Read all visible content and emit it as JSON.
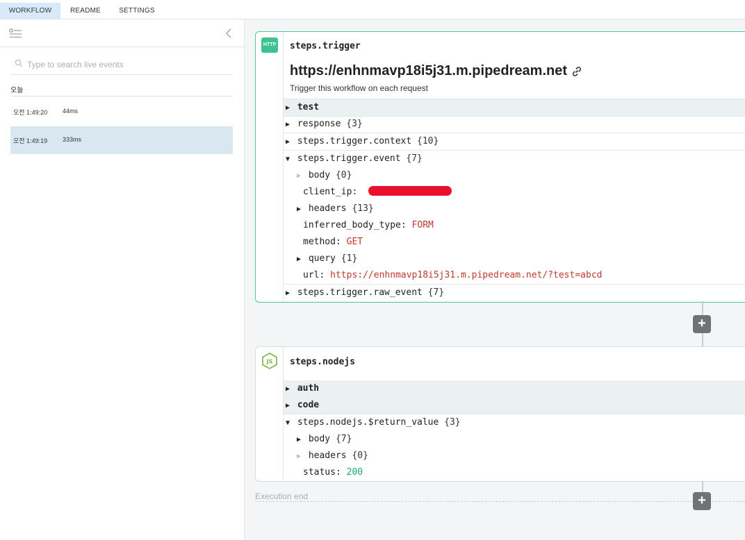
{
  "tabs": [
    {
      "label": "WORKFLOW",
      "active": true
    },
    {
      "label": "README",
      "active": false
    },
    {
      "label": "SETTINGS",
      "active": false
    }
  ],
  "sidebar": {
    "search_placeholder": "Type to search live events",
    "group_label": "오늘",
    "events": [
      {
        "time": "오전 1:49:20",
        "duration": "44ms",
        "selected": false
      },
      {
        "time": "오전 1:49:19",
        "duration": "333ms",
        "selected": true
      }
    ]
  },
  "trigger": {
    "badge": "HTTP",
    "name": "steps.trigger",
    "url": "https://enhnmavp18i5j31.m.pipedream.net",
    "description": "Trigger this workflow on each request",
    "rows": {
      "test": "test",
      "response": "response",
      "response_count": "{3}",
      "context": "steps.trigger.context",
      "context_count": "{10}",
      "event": "steps.trigger.event",
      "event_count": "{7}",
      "body": "body",
      "body_count": "{0}",
      "client_ip": "client_ip:",
      "headers": "headers",
      "headers_count": "{13}",
      "inferred": "inferred_body_type:",
      "inferred_value": "FORM",
      "method": "method:",
      "method_value": "GET",
      "query": "query",
      "query_count": "{1}",
      "url_key": "url:",
      "url_value": "https://enhnmavp18i5j31.m.pipedream.net/?test=abcd",
      "raw_event": "steps.trigger.raw_event",
      "raw_event_count": "{7}"
    }
  },
  "nodejs": {
    "name": "steps.nodejs",
    "rows": {
      "auth": "auth",
      "code": "code",
      "return_value": "steps.nodejs.$return_value",
      "return_count": "{3}",
      "body": "body",
      "body_count": "{7}",
      "headers": "headers",
      "headers_count": "{0}",
      "status": "status:",
      "status_value": "200"
    }
  },
  "footer": {
    "execution_end": "Execution end",
    "plus_label": "+"
  },
  "colors": {
    "accent_green": "#4cc79c",
    "selected_row": "#d9e8f0",
    "active_tab": "#d7eafc",
    "value_red": "#c0392b",
    "value_green": "#1aa86b",
    "redaction": "#e8102a"
  }
}
